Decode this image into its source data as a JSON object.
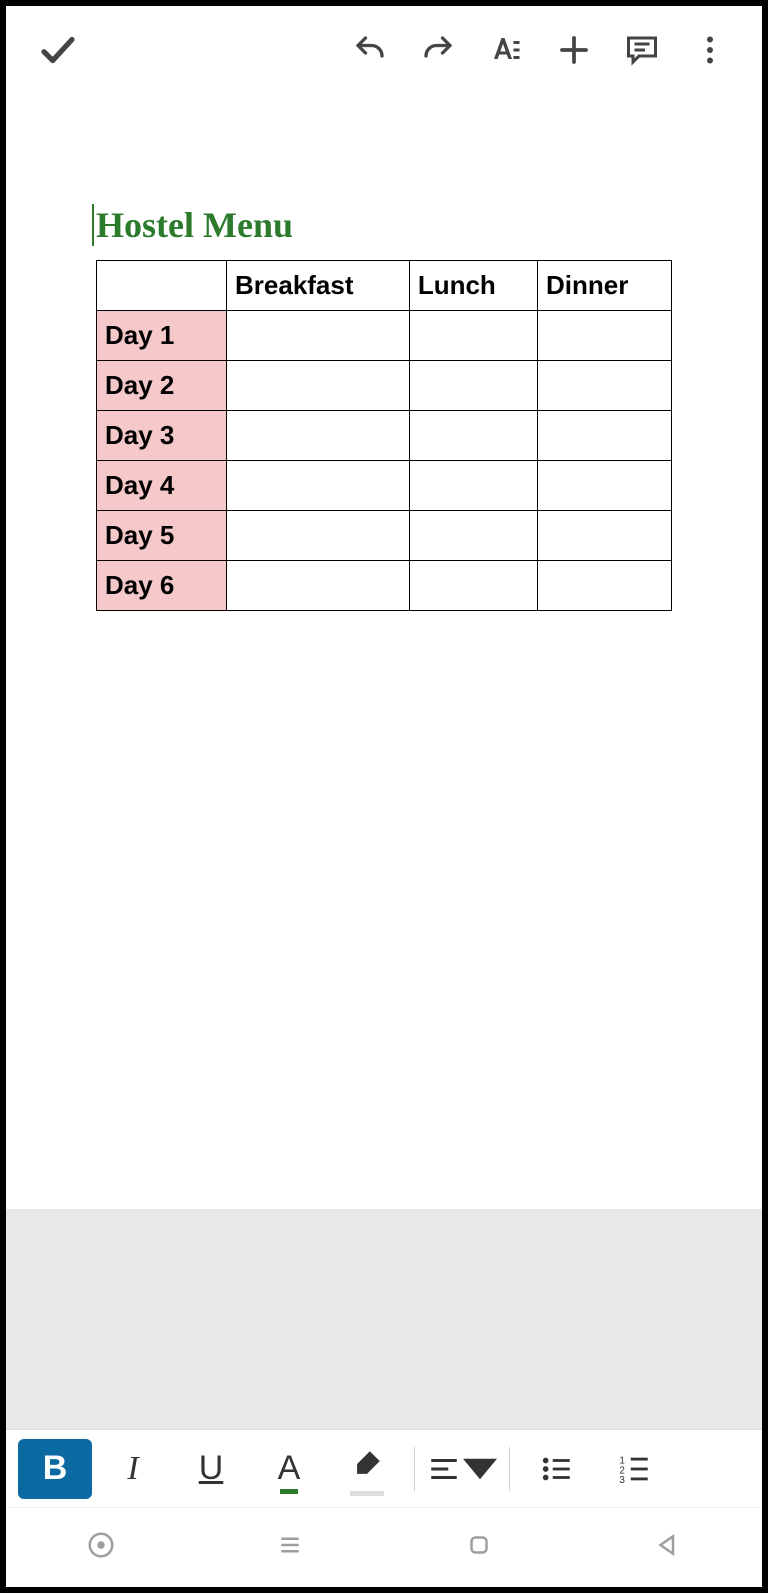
{
  "document": {
    "title": "Hostel Menu",
    "table": {
      "headers": [
        "",
        "Breakfast",
        "Lunch",
        "Dinner"
      ],
      "rows": [
        {
          "label": "Day 1",
          "cells": [
            "",
            "",
            ""
          ]
        },
        {
          "label": "Day 2",
          "cells": [
            "",
            "",
            ""
          ]
        },
        {
          "label": "Day 3",
          "cells": [
            "",
            "",
            ""
          ]
        },
        {
          "label": "Day 4",
          "cells": [
            "",
            "",
            ""
          ]
        },
        {
          "label": "Day 5",
          "cells": [
            "",
            "",
            ""
          ]
        },
        {
          "label": "Day 6",
          "cells": [
            "",
            "",
            ""
          ]
        }
      ]
    }
  },
  "toolbar": {
    "bold": "B",
    "italic": "I",
    "underline": "U",
    "textcolor": "A"
  },
  "colors": {
    "title": "#2c7a2c",
    "dayRow": "#f5c9c9",
    "boldActive": "#0b6aa2"
  }
}
